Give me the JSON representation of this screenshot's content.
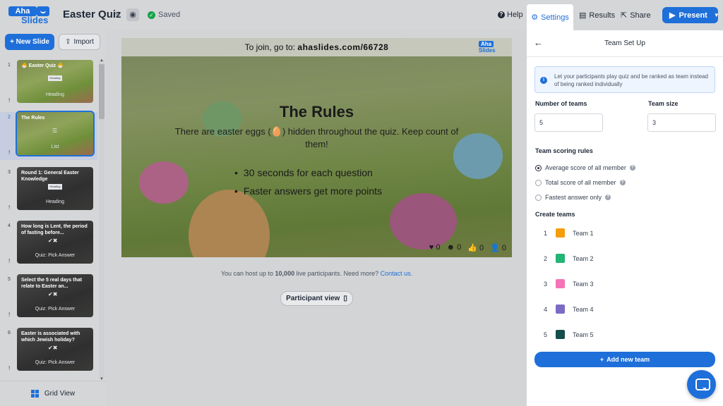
{
  "app": {
    "logo_top": "Aha",
    "logo_bottom": "Slides",
    "title": "Easter Quiz",
    "saved_label": "Saved"
  },
  "toolbar": {
    "help": "Help",
    "settings": "Settings",
    "results": "Results",
    "share": "Share",
    "present": "Present"
  },
  "sidebar": {
    "new_slide": "+ New Slide",
    "import": "Import",
    "grid_view": "Grid View",
    "slides": [
      {
        "num": "1",
        "title": "🐣 Easter Quiz 🐣",
        "label": "Heading",
        "box": "Heading"
      },
      {
        "num": "2",
        "title": "The Rules",
        "label": "List",
        "box": ""
      },
      {
        "num": "3",
        "title": "Round 1: General Easter Knowledge",
        "label": "Heading",
        "box": "Heading"
      },
      {
        "num": "4",
        "title": "How long is Lent, the period of fasting before...",
        "label": "Quiz: Pick Answer",
        "box": ""
      },
      {
        "num": "5",
        "title": "Select the 5 real days that relate to Easter an...",
        "label": "Quiz: Pick Answer",
        "box": ""
      },
      {
        "num": "6",
        "title": "Easter is associated with which Jewish holiday?",
        "label": "Quiz: Pick Answer",
        "box": ""
      }
    ]
  },
  "canvas": {
    "join_text": "To join, go to: ",
    "join_url": "ahaslides.com/66728",
    "mini_logo_top": "Aha",
    "mini_logo_bottom": "Slides",
    "title": "The Rules",
    "description": "There are easter eggs (🥚) hidden throughout the quiz. Keep count of them!",
    "bullets": [
      "30 seconds for each question",
      "Faster answers get more points"
    ],
    "reactions": {
      "hearts": "0",
      "smile": "0",
      "thumbs": "0",
      "people": "0"
    }
  },
  "footer": {
    "host_note_a": "You can host up to ",
    "host_note_bold": "10,000",
    "host_note_b": " live participants. Need more? ",
    "contact": "Contact us.",
    "participant_view": "Participant view"
  },
  "panel": {
    "title": "Team Set Up",
    "info": "Let your participants play quiz and be ranked as team instead of being ranked individually",
    "num_teams_label": "Number of teams",
    "num_teams_value": "5",
    "team_size_label": "Team size",
    "team_size_value": "3",
    "scoring_label": "Team scoring rules",
    "scoring_options": [
      "Average score of all member",
      "Total score of all member",
      "Fastest answer only"
    ],
    "scoring_selected": 0,
    "create_teams_label": "Create teams",
    "teams": [
      {
        "num": "1",
        "name": "Team 1",
        "color": "#f59e0b"
      },
      {
        "num": "2",
        "name": "Team 2",
        "color": "#22b573"
      },
      {
        "num": "3",
        "name": "Team 3",
        "color": "#f472b6"
      },
      {
        "num": "4",
        "name": "Team 4",
        "color": "#7c6bc4"
      },
      {
        "num": "5",
        "name": "Team 5",
        "color": "#134e4a"
      }
    ],
    "add_team": "Add new team"
  },
  "colors": {
    "accent": "#1e6fd9",
    "success": "#16a34a"
  }
}
